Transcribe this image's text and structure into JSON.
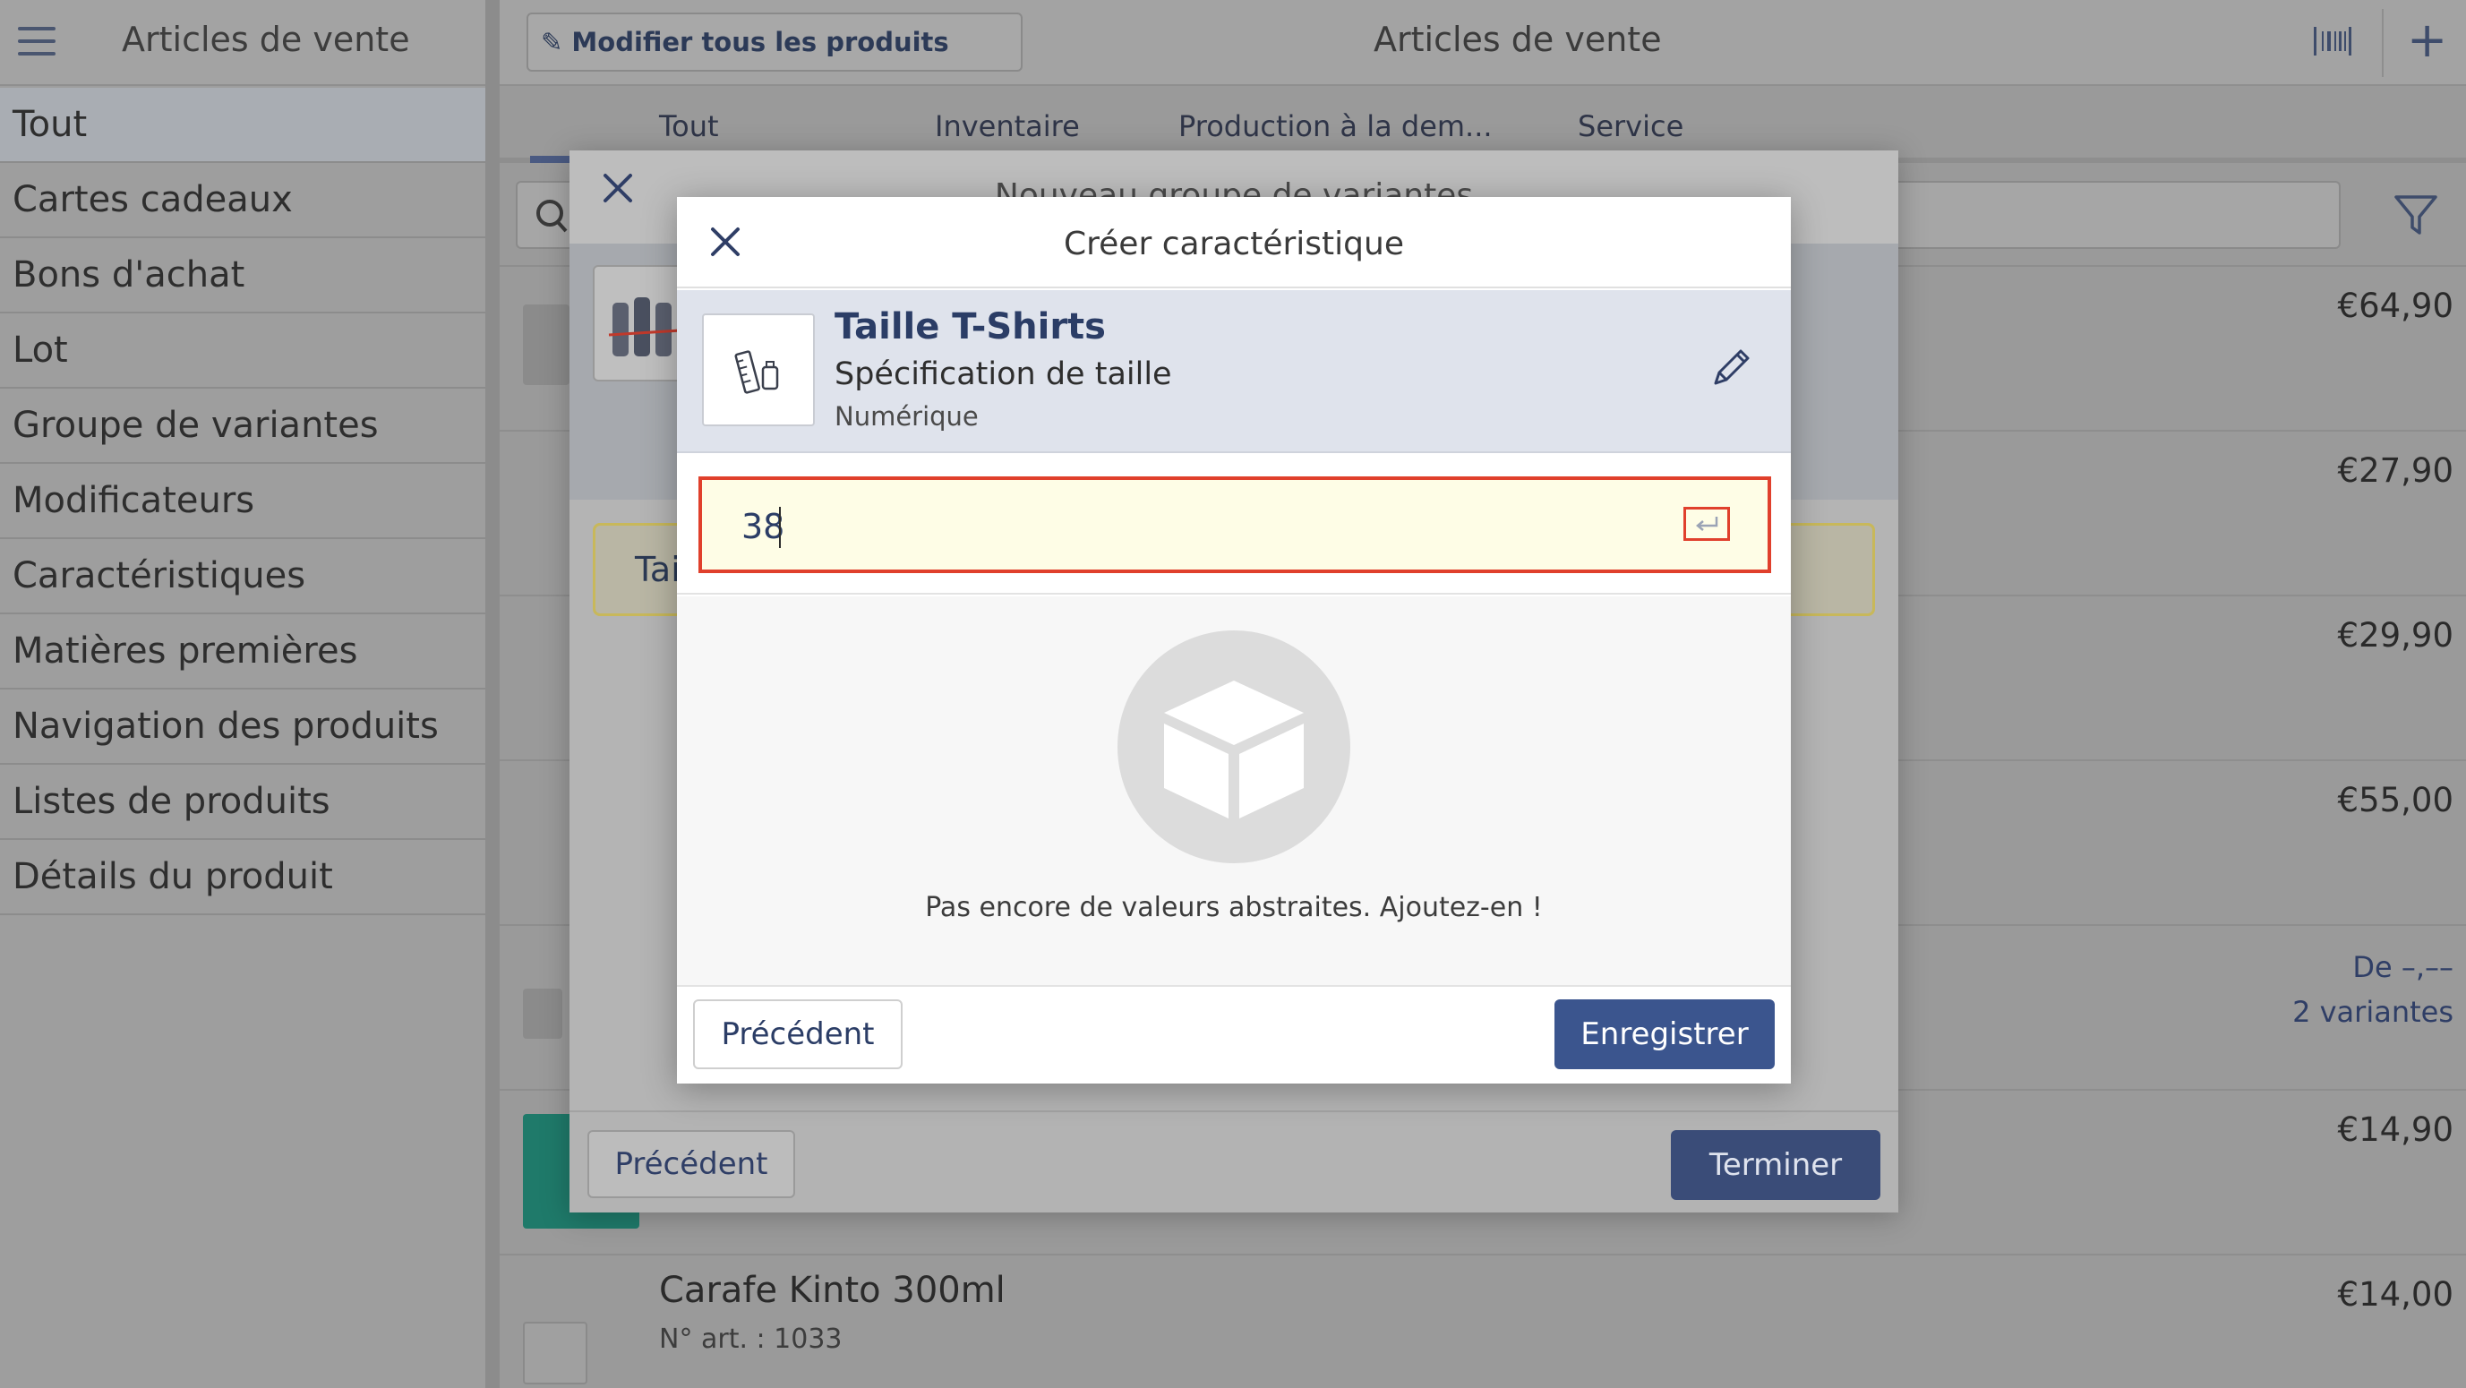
{
  "sidebar": {
    "title": "Articles de vente",
    "items": [
      {
        "label": "Tout"
      },
      {
        "label": "Cartes cadeaux"
      },
      {
        "label": "Bons d'achat"
      },
      {
        "label": "Lot"
      },
      {
        "label": "Groupe de variantes"
      },
      {
        "label": "Modificateurs"
      },
      {
        "label": "Caractéristiques"
      },
      {
        "label": "Matières premières"
      },
      {
        "label": "Navigation des produits"
      },
      {
        "label": "Listes de produits"
      },
      {
        "label": "Détails du produit"
      }
    ]
  },
  "header": {
    "edit_all_label": "Modifier tous les produits",
    "title": "Articles de vente",
    "add_label": "+"
  },
  "tabs": [
    {
      "label": "Tout"
    },
    {
      "label": "Inventaire"
    },
    {
      "label": "Production à la dem..."
    },
    {
      "label": "Service"
    }
  ],
  "products": {
    "prices": [
      "€64,90",
      "€27,90",
      "€29,90",
      "€55,00",
      "€14,90",
      "€14,00"
    ],
    "variant_price": "De –,––",
    "variant_count": "2 variantes",
    "last_name": "Carafe Kinto 300ml",
    "last_article": "N° art. : 1033"
  },
  "dialog_back": {
    "title": "Nouveau groupe de variantes",
    "yellow_text": "Tai",
    "prev_label": "Précédent",
    "finish_label": "Terminer"
  },
  "dialog": {
    "title": "Créer caractéristique",
    "characteristic_name": "Taille T-Shirts",
    "characteristic_desc": "Spécification de taille",
    "characteristic_type": "Numérique",
    "input_value": "38",
    "empty_text": "Pas encore de valeurs abstraites. Ajoutez-en !",
    "prev_label": "Précédent",
    "save_label": "Enregistrer"
  },
  "colors": {
    "accent": "#3b558e",
    "title_blue": "#2b3d66",
    "error_red": "#e0402c",
    "input_bg": "#fefde6"
  }
}
